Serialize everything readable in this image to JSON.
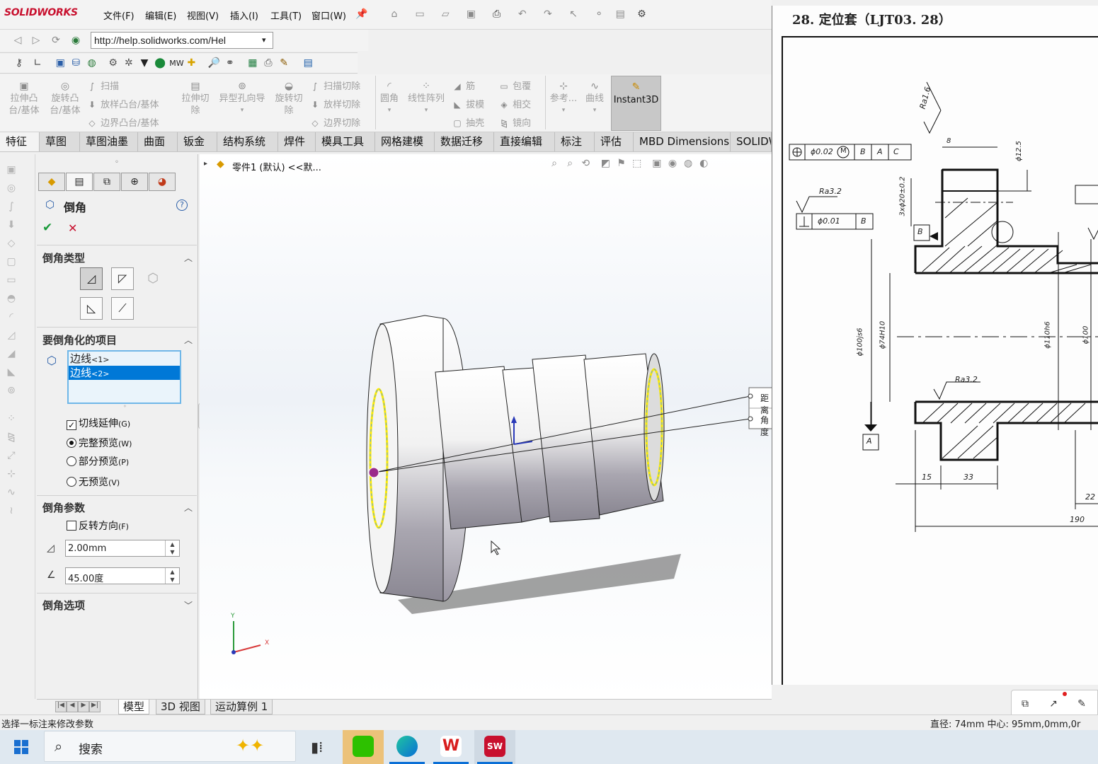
{
  "app": {
    "logo": "SOLIDWORKS",
    "menu": [
      "文件(F)",
      "编辑(E)",
      "视图(V)",
      "插入(I)",
      "工具(T)",
      "窗口(W)"
    ],
    "url": "http://help.solidworks.com/Hel"
  },
  "ribbon": {
    "extrude_boss": "拉伸凸\n台/基体",
    "revolve_boss": "旋转凸\n台/基体",
    "sweep": "扫描",
    "loft_boss": "放样凸台/基体",
    "boundary_boss": "边界凸台/基体",
    "extrude_cut": "拉伸切\n除",
    "hole_wizard": "异型孔向导",
    "revolve_cut": "旋转切\n除",
    "sweep_cut": "扫描切除",
    "loft_cut": "放样切除",
    "boundary_cut": "边界切除",
    "fillet": "圆角",
    "linear_pattern": "线性阵列",
    "rib": "筋",
    "draft": "拔模",
    "shell": "抽壳",
    "wrap": "包覆",
    "intersect": "相交",
    "mirror": "镜向",
    "reference": "参考...",
    "curves": "曲线",
    "instant3d": "Instant3D"
  },
  "tabs": [
    "特征",
    "草图",
    "草图油墨",
    "曲面",
    "钣金",
    "结构系统",
    "焊件",
    "模具工具",
    "网格建模",
    "数据迁移",
    "直接编辑",
    "标注",
    "评估",
    "MBD Dimensions",
    "SOLIDW"
  ],
  "tree": {
    "part_label": "零件1 (默认) <<默..."
  },
  "panel": {
    "title": "倒角",
    "help": "?",
    "ok": "✔",
    "cancel": "✕",
    "chamfer_type_title": "倒角类型",
    "items_title": "要倒角化的项目",
    "edges": [
      {
        "name": "边线",
        "index": "<1>",
        "selected": false
      },
      {
        "name": "边线",
        "index": "<2>",
        "selected": true
      }
    ],
    "tangent_propagation": "切线延伸",
    "tangent_key": "(G)",
    "full_preview": "完整预览",
    "full_key": "(W)",
    "partial_preview": "部分预览",
    "partial_key": "(P)",
    "no_preview": "无预览",
    "no_key": "(V)",
    "params_title": "倒角参数",
    "reverse_direction": "反转方向",
    "reverse_key": "(F)",
    "distance_value": "2.00mm",
    "angle_value": "45.00度",
    "options_title": "倒角选项"
  },
  "viewport": {
    "callout_distance": "距离",
    "callout_angle": "角度",
    "axis_x": "X",
    "axis_y": "Y"
  },
  "drawing": {
    "title": "28. 定位套（LJT03. 28）",
    "labels": {
      "ra16": "Ra1.6",
      "ra32a": "Ra3.2",
      "ra32b": "Ra3.2",
      "pos_tol": "ϕ0.02",
      "mmc": "M",
      "datum_b": "B",
      "datum_a": "A",
      "datum_c": "C",
      "perp_tol": "ϕ0.01",
      "perp_datum": "B",
      "holes": "3xϕ20±0.2",
      "d125": "ϕ12.5",
      "dim8": "8",
      "d100js6": "ϕ100js6",
      "d74h10": "ϕ74H10",
      "d110h6": "ϕ110h6",
      "d100": "ϕ100",
      "dim15": "15",
      "dim33": "33",
      "dim22": "22",
      "dim190": "190",
      "datum_b_box": "B",
      "datum_a_box": "A"
    }
  },
  "bottom_tabs": [
    "模型",
    "3D 视图",
    "运动算例 1"
  ],
  "status": {
    "left": "选择一标注来修改参数",
    "right": "直径: 74mm  中心: 95mm,0mm,0r"
  },
  "taskbar": {
    "search": "搜索"
  }
}
